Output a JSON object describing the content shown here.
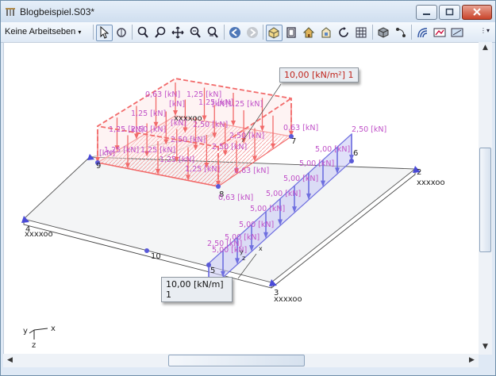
{
  "window": {
    "title": "Blogbeispiel.S03*"
  },
  "toolbar": {
    "workplane_label": "Keine Arbeitseben",
    "overflow_label": "⋮▾"
  },
  "model": {
    "surface_load_label": "10,00 [kN/m²] 1",
    "line_load_label": "10,00 [kN/m] 1",
    "node_labels": [
      "9",
      "7",
      "8",
      "6",
      "2",
      "4",
      "10",
      "5",
      "3"
    ],
    "support_labels": [
      "xxxxoo",
      "xxxxoo",
      "xxxxoo",
      "xxxxoo"
    ],
    "red_load_labels": [
      "0,63 [kN]",
      "1,25 [kN]",
      "1,25 [kN]",
      "[kN]",
      "[kN]",
      "1,25 [kN]",
      "1,25 [kN]",
      "2,50 [kN]",
      "2,50 [kN]",
      "[kN]",
      "1,25 [kN]",
      "2,50 [kN]",
      "2,50 [kN]",
      "2,50 [kN]",
      "0,63 [kN]",
      "[kN]",
      "1,25 [kN]",
      "1,25 [kN]",
      "1,25 [kN]",
      "1,25 [kN]",
      "0,63 [kN]"
    ],
    "blue_load_labels": [
      "2,50 [kN]",
      "0,63 [kN]",
      "5,00 [kN]",
      "5,00 [kN]",
      "5,00 [kN]",
      "5,00 [kN]",
      "5,00 [kN]",
      "5,00 [kN]",
      "5,00 [kN]",
      "5,00 [kN]",
      "2,50 [kN]"
    ],
    "local_axes": [
      "y",
      "x",
      "z"
    ]
  },
  "axis_triad": {
    "x": "x",
    "y": "y",
    "z": "z"
  },
  "colors": {
    "load_red": "#f26a6a",
    "load_fill": "#f7b8b8",
    "line_load": "#6f6fe0",
    "load_text": "#c050c8",
    "grid": "#8c8c8c"
  }
}
